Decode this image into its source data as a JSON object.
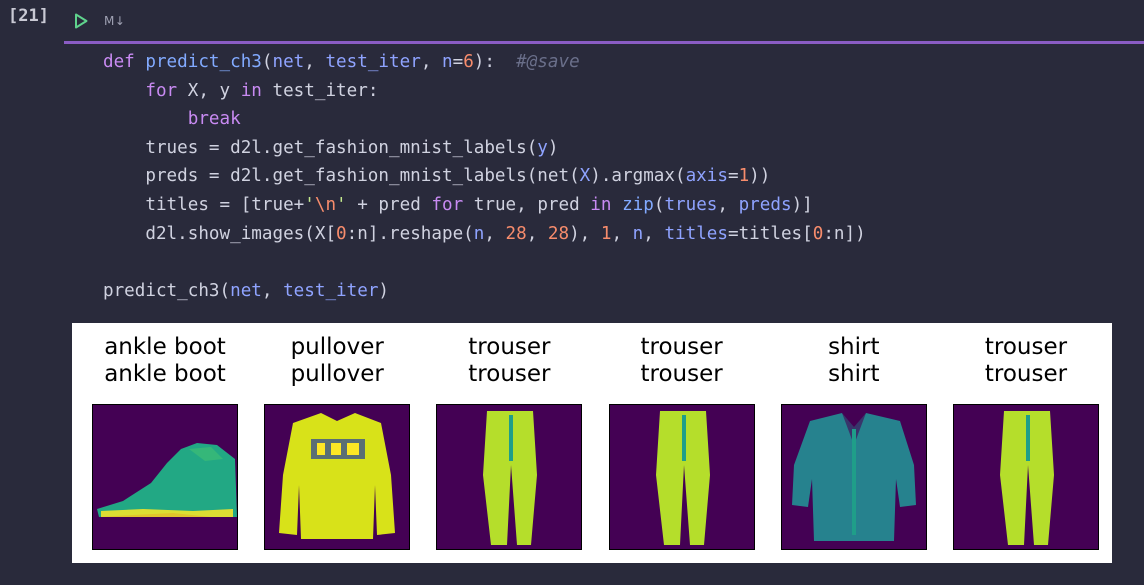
{
  "cell": {
    "execution_count": "[21]",
    "markdown_toggle": "M↓"
  },
  "code_lines": [
    [
      [
        "kw",
        "def "
      ],
      [
        "fn",
        "predict_ch3"
      ],
      [
        "plain",
        "("
      ],
      [
        "param",
        "net"
      ],
      [
        "plain",
        ", "
      ],
      [
        "param",
        "test_iter"
      ],
      [
        "plain",
        ", "
      ],
      [
        "param",
        "n"
      ],
      [
        "plain",
        "="
      ],
      [
        "num",
        "6"
      ],
      [
        "plain",
        "):  "
      ],
      [
        "cm",
        "#@save"
      ]
    ],
    [
      [
        "plain",
        "    "
      ],
      [
        "kw",
        "for"
      ],
      [
        "plain",
        " X, y "
      ],
      [
        "kw",
        "in"
      ],
      [
        "plain",
        " test_iter:"
      ]
    ],
    [
      [
        "plain",
        "        "
      ],
      [
        "kw",
        "break"
      ]
    ],
    [
      [
        "plain",
        "    trues = d2l.get_fashion_mnist_labels("
      ],
      [
        "param",
        "y"
      ],
      [
        "plain",
        ")"
      ]
    ],
    [
      [
        "plain",
        "    preds = d2l.get_fashion_mnist_labels(net("
      ],
      [
        "param",
        "X"
      ],
      [
        "plain",
        ").argmax("
      ],
      [
        "param",
        "axis"
      ],
      [
        "plain",
        "="
      ],
      [
        "num",
        "1"
      ],
      [
        "plain",
        "))"
      ]
    ],
    [
      [
        "plain",
        "    titles = [true+"
      ],
      [
        "str",
        "'"
      ],
      [
        "esc",
        "\\n"
      ],
      [
        "str",
        "'"
      ],
      [
        "plain",
        " + pred "
      ],
      [
        "kw",
        "for"
      ],
      [
        "plain",
        " true, pred "
      ],
      [
        "kw",
        "in"
      ],
      [
        "plain",
        " "
      ],
      [
        "builtin",
        "zip"
      ],
      [
        "plain",
        "("
      ],
      [
        "param",
        "trues"
      ],
      [
        "plain",
        ", "
      ],
      [
        "param",
        "preds"
      ],
      [
        "plain",
        ")]"
      ]
    ],
    [
      [
        "plain",
        "    d2l.show_images(X["
      ],
      [
        "num",
        "0"
      ],
      [
        "plain",
        ":n].reshape("
      ],
      [
        "param",
        "n"
      ],
      [
        "plain",
        ", "
      ],
      [
        "num",
        "28"
      ],
      [
        "plain",
        ", "
      ],
      [
        "num",
        "28"
      ],
      [
        "plain",
        "), "
      ],
      [
        "num",
        "1"
      ],
      [
        "plain",
        ", "
      ],
      [
        "param",
        "n"
      ],
      [
        "plain",
        ", "
      ],
      [
        "param",
        "titles"
      ],
      [
        "plain",
        "=titles["
      ],
      [
        "num",
        "0"
      ],
      [
        "plain",
        ":n])"
      ]
    ],
    [],
    [
      [
        "plain",
        "predict_ch3("
      ],
      [
        "param",
        "net"
      ],
      [
        "plain",
        ", "
      ],
      [
        "param",
        "test_iter"
      ],
      [
        "plain",
        ")"
      ]
    ]
  ],
  "output": {
    "images": [
      {
        "true_label": "ankle boot",
        "pred_label": "ankle boot",
        "icon": "ankle-boot-image"
      },
      {
        "true_label": "pullover",
        "pred_label": "pullover",
        "icon": "pullover-image"
      },
      {
        "true_label": "trouser",
        "pred_label": "trouser",
        "icon": "trouser-image"
      },
      {
        "true_label": "trouser",
        "pred_label": "trouser",
        "icon": "trouser-image"
      },
      {
        "true_label": "shirt",
        "pred_label": "shirt",
        "icon": "shirt-image"
      },
      {
        "true_label": "trouser",
        "pred_label": "trouser",
        "icon": "trouser-image"
      }
    ]
  },
  "colors": {
    "background": "#292a3b",
    "divider": "#8a5cc4",
    "image_background": "#440154",
    "image_fill": "#22a884",
    "image_highlight": "#fde725"
  }
}
